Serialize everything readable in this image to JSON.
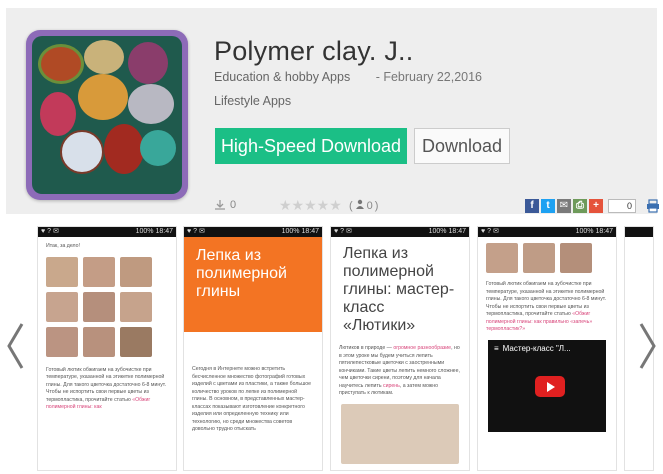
{
  "app": {
    "title": "Polymer clay. J..",
    "category": "Education & hobby Apps",
    "date": "- February 22,2016",
    "category2": "Lifestyle Apps",
    "downloads": "0",
    "stars": "★★★★★",
    "rating_count": "0"
  },
  "buttons": {
    "high_speed": "High-Speed Download",
    "download": "Download"
  },
  "share": {
    "count": "0",
    "items": [
      "facebook-icon",
      "twitter-icon",
      "email-icon",
      "print-share-icon",
      "plus-icon"
    ],
    "colors": [
      "#3b5998",
      "#1da1f2",
      "#7a7a7a",
      "#6e9a5a",
      "#e5533b"
    ]
  },
  "gallery": {
    "statusbar_left": "♥ ? ✉",
    "statusbar_right": "100% 18:47",
    "shot1": {
      "intro": "Итак, за дело!",
      "text": "Готовый лютик обжигаем на зубочистке при температуре, указанной на этикетке полимерной глины. Для такого цветочка достаточно 6-8 минут. Чтобы не испортить свои первые цветы из термопластика, прочитайте статью",
      "link": "«Обжиг полимерной глины: как"
    },
    "shot2": {
      "header": "Лепка из полимерной глины",
      "text": "Сегодня в Интернете можно встретить бесчисленное множество фотографий готовых изделий с цветами из пластики, а также большое количество уроков по лепке из полимерной глины. В основном, в представленных мастер-классах показывают изготовление конкретного изделия или определенную технику или технологию, но среди множества советов довольно трудно отыскать"
    },
    "shot3": {
      "header": "Лепка из полимерной глины: мастер-класс «Лютики»",
      "text_a": "Лютиков в природе —",
      "text_link": "огромное разнообразие",
      "text_b": ", но в этом уроке мы будем учиться лепить пятилепестковые цветочки с заостренными кончиками. Такие цветы лепить немного сложнее, чем цветочки сирени, поэтому для начала научитесь лепить",
      "text_link2": "сирень",
      "text_c": ", а затем можно приступать к лютикам."
    },
    "shot4": {
      "text": "Готовый лютик обжигаем на зубочистке при температуре, указанной на этикетке полимерной глины. Для такого цветочка достаточно 6-8 минут. Чтобы не испортить свои первые цветы из термопластика, прочитайте статью",
      "link": "«Обжиг полимерной глины: как правильно «запечь» термопластик?»",
      "video_title": "Мастер-класс \"Л..."
    }
  }
}
